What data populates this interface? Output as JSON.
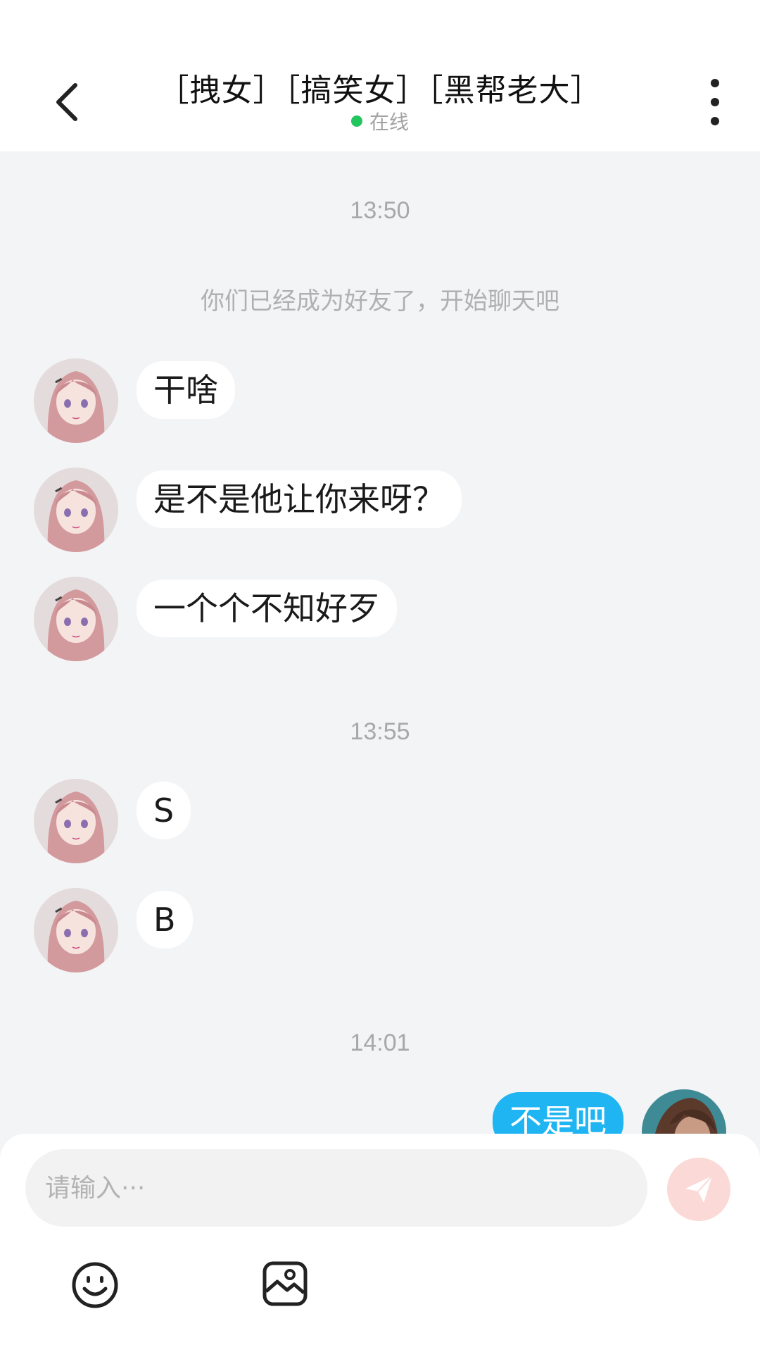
{
  "header": {
    "title": "［拽女］［搞笑女］［黑帮老大］",
    "status": "在线"
  },
  "chat": {
    "time_1": "13:50",
    "system_notice": "你们已经成为好友了，开始聊天吧",
    "incoming_1": [
      "干啥",
      "是不是他让你来呀？",
      "一个个不知好歹"
    ],
    "time_2": "13:55",
    "incoming_2": [
      "S",
      "B"
    ],
    "time_3": "14:01",
    "outgoing": [
      "不是吧"
    ]
  },
  "composer": {
    "placeholder": "请输入···"
  },
  "icons": {
    "back": "chevron-left-icon",
    "more": "more-vertical-icon",
    "send": "paper-plane-icon",
    "emoji": "smiley-icon",
    "image": "image-icon"
  },
  "colors": {
    "online": "#22c55e",
    "outgoing_bubble": "#1fb4f2",
    "send_button": "#fbd9d6",
    "chat_background": "#f3f4f6"
  }
}
